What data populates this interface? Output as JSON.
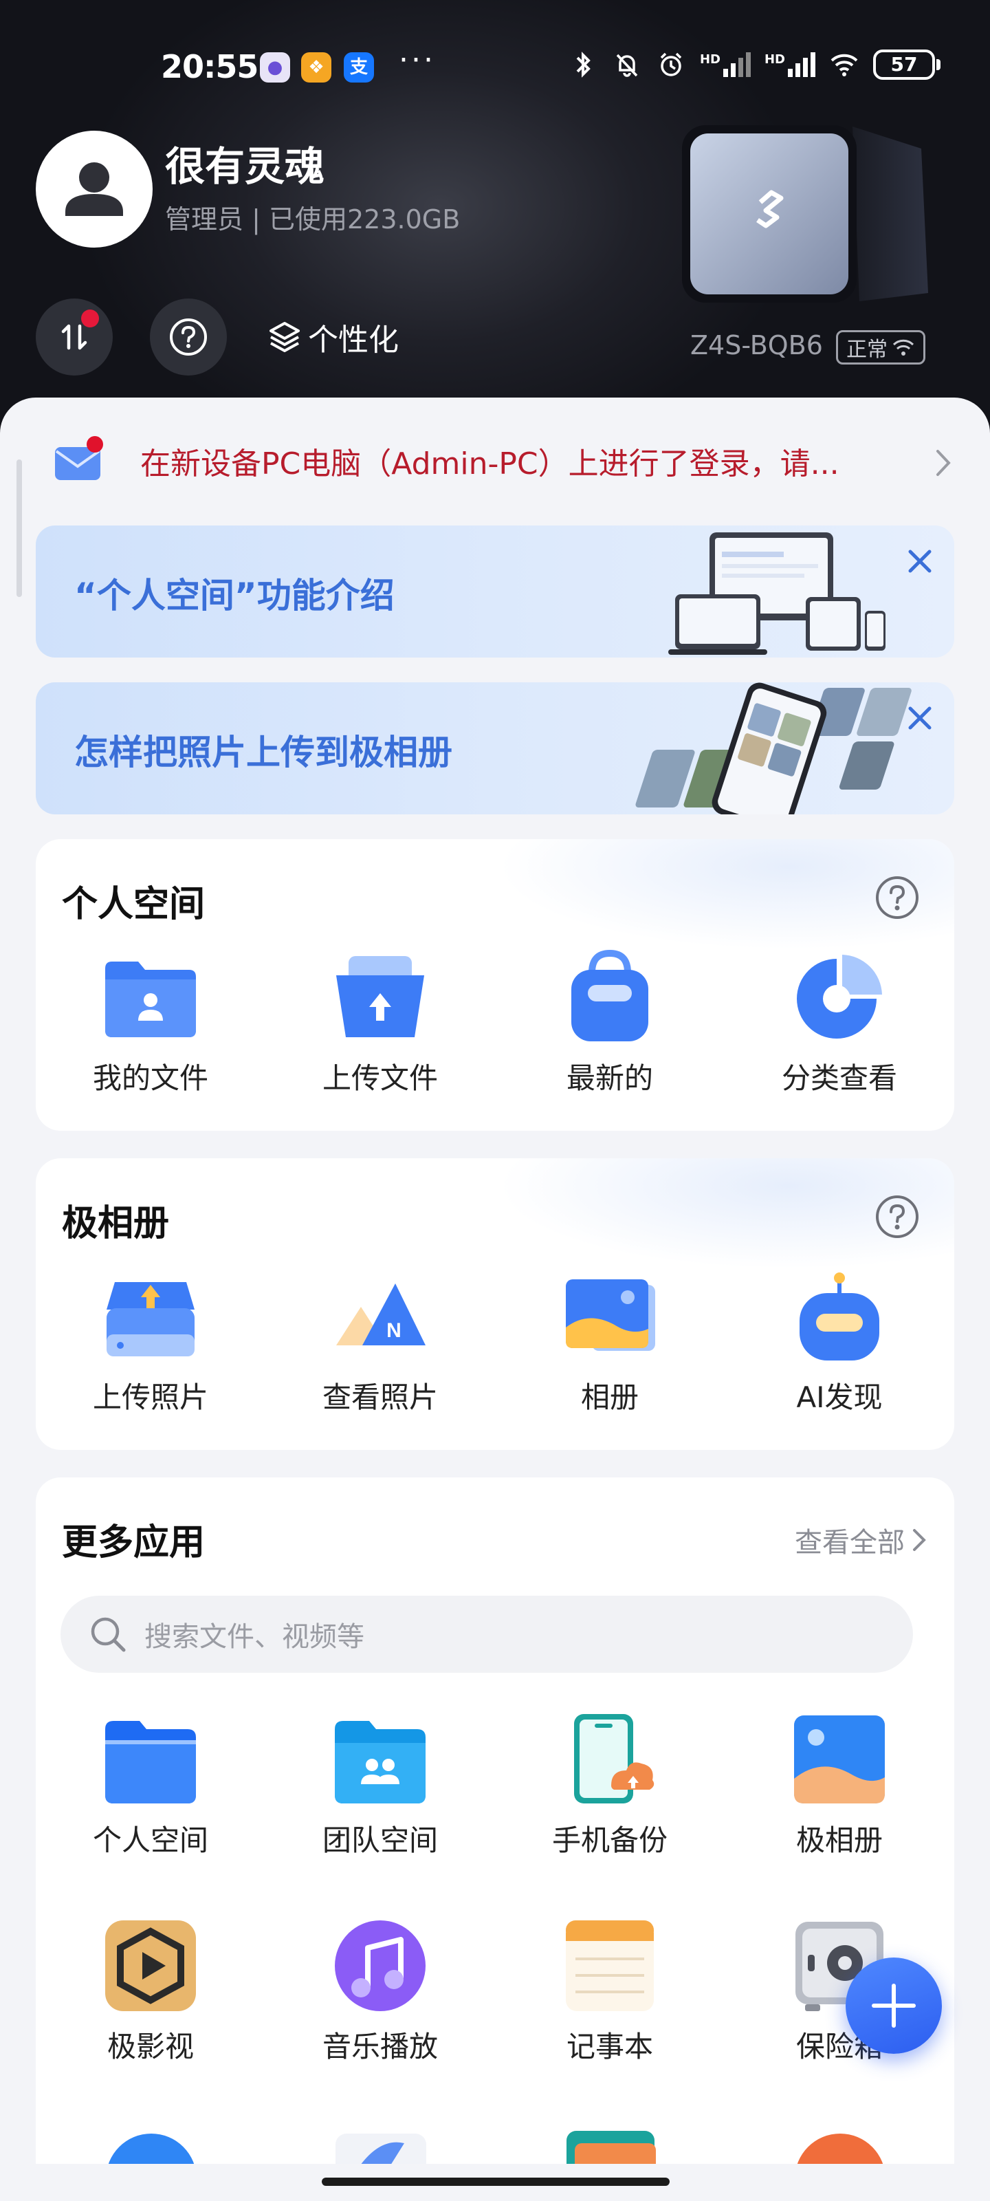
{
  "status_bar": {
    "time": "20:55",
    "hd1": "HD",
    "hd2": "HD",
    "battery": "57",
    "pay_icon_text": "支"
  },
  "profile": {
    "name": "很有灵魂",
    "role_usage": "管理员 | 已使用223.0GB"
  },
  "header_actions": {
    "personalize_label": "个性化"
  },
  "device": {
    "name": "Z4S-BQB6",
    "status": "正常"
  },
  "notice": {
    "text": "在新设备PC电脑（Admin-PC）上进行了登录，请..."
  },
  "banners": [
    {
      "title": "“个人空间”功能介绍"
    },
    {
      "title": "怎样把照片上传到极相册"
    }
  ],
  "personal_space": {
    "title": "个人空间",
    "items": [
      {
        "label": "我的文件",
        "icon": "my-files-icon"
      },
      {
        "label": "上传文件",
        "icon": "upload-file-icon"
      },
      {
        "label": "最新的",
        "icon": "recent-icon"
      },
      {
        "label": "分类查看",
        "icon": "category-view-icon"
      }
    ]
  },
  "album": {
    "title": "极相册",
    "items": [
      {
        "label": "上传照片",
        "icon": "upload-photo-icon"
      },
      {
        "label": "查看照片",
        "icon": "view-photos-icon"
      },
      {
        "label": "相册",
        "icon": "album-icon"
      },
      {
        "label": "AI发现",
        "icon": "ai-discover-icon"
      }
    ]
  },
  "more_apps": {
    "title": "更多应用",
    "view_all": "查看全部",
    "search_placeholder": "搜索文件、视频等",
    "row1": [
      {
        "label": "个人空间",
        "icon": "personal-space-folder-icon"
      },
      {
        "label": "团队空间",
        "icon": "team-space-folder-icon"
      },
      {
        "label": "手机备份",
        "icon": "phone-backup-icon"
      },
      {
        "label": "极相册",
        "icon": "photo-album-app-icon"
      }
    ],
    "row2": [
      {
        "label": "极影视",
        "icon": "video-app-icon"
      },
      {
        "label": "音乐播放",
        "icon": "music-player-icon"
      },
      {
        "label": "记事本",
        "icon": "notepad-icon"
      },
      {
        "label": "保险箱",
        "icon": "safe-box-icon"
      }
    ]
  },
  "colors": {
    "accent": "#2c5ef0",
    "notice_red": "#b71c2c",
    "banner_blue": "#3a6fd8"
  }
}
